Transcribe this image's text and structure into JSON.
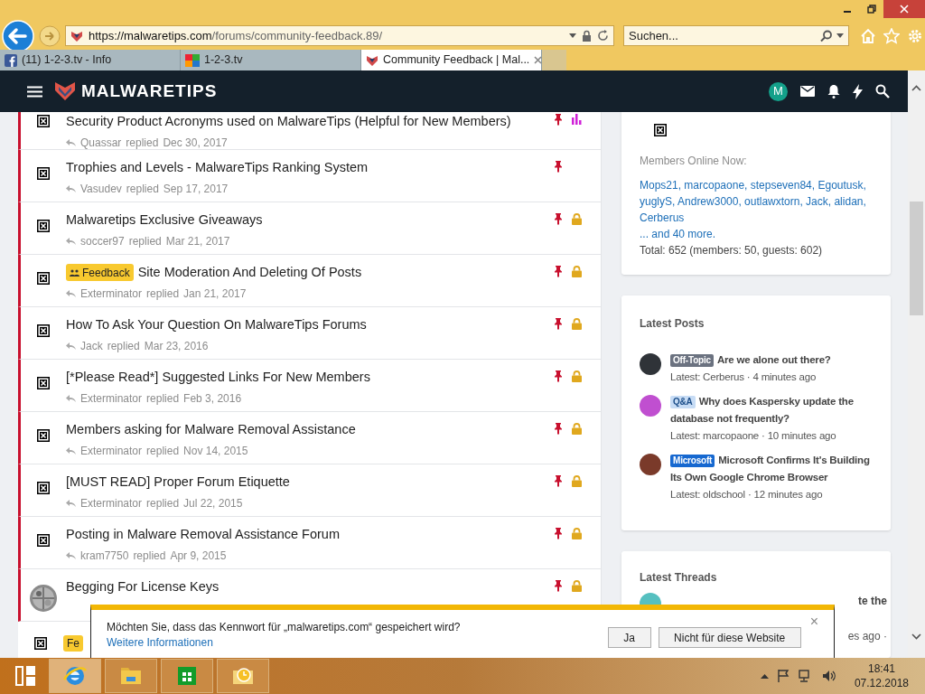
{
  "browser": {
    "url_host": "https://malwaretips.com",
    "url_path": "/forums/community-feedback.89/",
    "search": {
      "placeholder": "Suchen..."
    },
    "tabs": [
      {
        "label": "(11) 1-2-3.tv - Info",
        "selected": false
      },
      {
        "label": "1-2-3.tv",
        "selected": false
      },
      {
        "label": "Community Feedback | Mal...",
        "selected": true
      }
    ]
  },
  "site": {
    "logo": "MALWARETIPS",
    "user_initial": "M"
  },
  "threads": [
    {
      "kind": "plain",
      "title": "Security Product Acronyms used on MalwareTips (Helpful for New Members)",
      "user": "Quassar",
      "action": "replied",
      "date": "Dec 30, 2017",
      "locked": false,
      "poll": true
    },
    {
      "kind": "plain",
      "title": "Trophies and Levels - MalwareTips Ranking System",
      "user": "Vasudev",
      "action": "replied",
      "date": "Sep 17, 2017",
      "locked": false,
      "poll": false
    },
    {
      "kind": "plain",
      "title": "Malwaretips Exclusive Giveaways",
      "user": "soccer97",
      "action": "replied",
      "date": "Mar 21, 2017",
      "locked": true,
      "poll": false
    },
    {
      "kind": "plain",
      "badge": "Feedback",
      "title": "Site Moderation And Deleting Of Posts",
      "user": "Exterminator",
      "action": "replied",
      "date": "Jan 21, 2017",
      "locked": true,
      "poll": false
    },
    {
      "kind": "plain",
      "title": "How To Ask Your Question On MalwareTips Forums",
      "user": "Jack",
      "action": "replied",
      "date": "Mar 23, 2016",
      "locked": true,
      "poll": false
    },
    {
      "kind": "plain",
      "title": "[*Please Read*] Suggested Links For New Members",
      "user": "Exterminator",
      "action": "replied",
      "date": "Feb 3, 2016",
      "locked": true,
      "poll": false
    },
    {
      "kind": "plain",
      "title": "Members asking for Malware Removal Assistance",
      "user": "Exterminator",
      "action": "replied",
      "date": "Nov 14, 2015",
      "locked": true,
      "poll": false
    },
    {
      "kind": "plain",
      "title": "[MUST READ] Proper Forum Etiquette",
      "user": "Exterminator",
      "action": "replied",
      "date": "Jul 22, 2015",
      "locked": true,
      "poll": false
    },
    {
      "kind": "plain",
      "title": "Posting in Malware Removal Assistance Forum",
      "user": "kram7750",
      "action": "replied",
      "date": "Apr 9, 2015",
      "locked": true,
      "poll": false
    },
    {
      "kind": "picture",
      "title": "Begging For License Keys",
      "locked": true,
      "poll": false
    }
  ],
  "last_row_badge": "Fe",
  "online": {
    "heading": "Members Online Now:",
    "members": "Mops21, marcopaone, stepseven84, Egoutusk, yuglyS, Andrew3000, outlawxtorn, Jack, alidan, Cerberus",
    "more": "... and 40 more.",
    "total": "Total: 652 (members: 50, guests: 602)"
  },
  "latest_posts": {
    "heading": "Latest Posts",
    "items": [
      {
        "tag": "Off-Topic",
        "color": "#6b7280",
        "title": "Are we alone out there?",
        "meta": "Latest: Cerberus · 4 minutes ago"
      },
      {
        "tag": "Q&A",
        "color": "#c7dcf5",
        "title": "Why does Kaspersky update the database not frequently?",
        "meta": "Latest: marcopaone · 10 minutes ago"
      },
      {
        "tag": "Microsoft",
        "color": "#1668d0",
        "title": "Microsoft Confirms It's Building Its Own Google Chrome Browser",
        "meta": "Latest: oldschool · 12 minutes ago"
      }
    ]
  },
  "latest_threads": {
    "heading": "Latest Threads",
    "title_fragment": "te the",
    "meta_fragment": "es ago ·"
  },
  "password_prompt": {
    "message": "Möchten Sie, dass das Kennwort für „malwaretips.com“ gespeichert wird?",
    "link": "Weitere Informationen",
    "buttons": [
      "Ja",
      "Nicht für diese Website"
    ],
    "close": "×"
  },
  "taskbar": {
    "time": "18:41",
    "date": "07.12.2018"
  }
}
